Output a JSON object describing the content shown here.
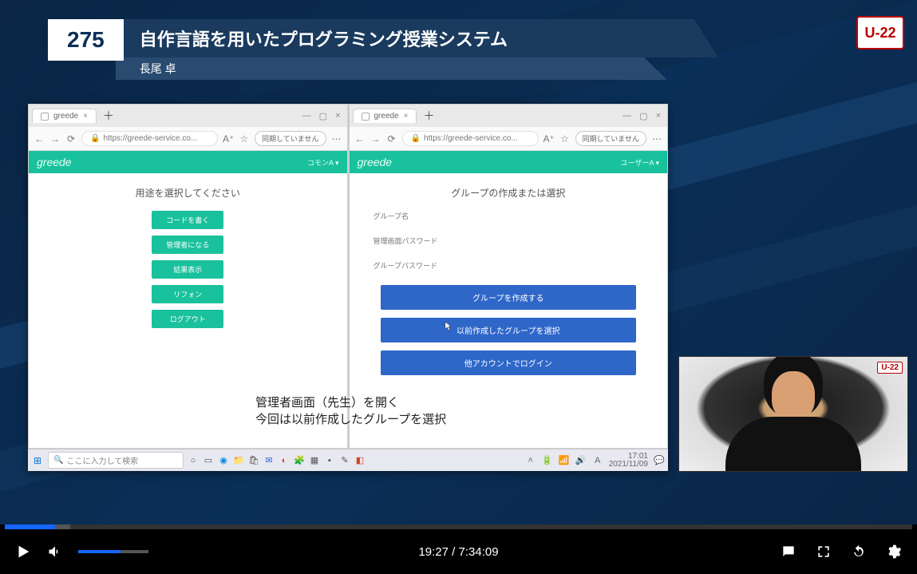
{
  "banner": {
    "number": "275",
    "title": "自作言語を用いたプログラミング授業システム",
    "author": "長尾 卓"
  },
  "logo": "U-22",
  "browsers": {
    "left": {
      "tab_label": "greede",
      "url": "https://greede-service.co...",
      "sync_label": "同期していません",
      "app_name": "greede",
      "app_role": "コモンA ▾",
      "page_title": "用途を選択してください",
      "buttons": [
        "コードを書く",
        "管理者になる",
        "結果表示",
        "リフォン",
        "ログアウト"
      ]
    },
    "right": {
      "tab_label": "greede",
      "url": "https://greede-service.co...",
      "sync_label": "同期していません",
      "app_name": "greede",
      "app_role": "ユーザーA ▾",
      "page_title": "グループの作成または選択",
      "fields": [
        "グループ名",
        "管理画面パスワード",
        "グループパスワード"
      ],
      "blue_buttons": [
        "グループを作成する",
        "以前作成したグループを選択",
        "他アカウントでログイン"
      ]
    }
  },
  "caption_line1": "管理者画面（先生）を開く",
  "caption_line2": "今回は以前作成したグループを選択",
  "taskbar": {
    "search_placeholder": "ここに入力して検索",
    "clock_time": "17:01",
    "clock_date": "2021/11/09"
  },
  "player": {
    "current": "19:27",
    "total": "7:34:09"
  }
}
